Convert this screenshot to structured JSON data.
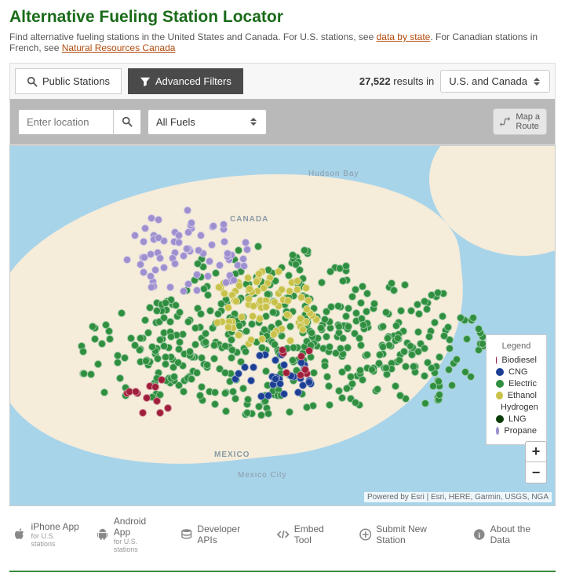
{
  "title": "Alternative Fueling Station Locator",
  "subtitle_parts": {
    "pre": "Find alternative fueling stations in the United States and Canada. For U.S. stations, see ",
    "link1": "data by state",
    "mid": ". For Canadian stations in French, see ",
    "link2": "Natural Resources Canada"
  },
  "tabs": {
    "public": "Public Stations",
    "advanced": "Advanced Filters"
  },
  "results": {
    "count": "27,522",
    "suffix": "results in"
  },
  "region": "U.S. and Canada",
  "search": {
    "placeholder": "Enter location"
  },
  "fuel_select": "All Fuels",
  "route_btn": "Map a\nRoute",
  "map_labels": {
    "hudson": "Hudson Bay",
    "canada": "CANADA",
    "mexico": "MEXICO",
    "mexcity": "Mexico City"
  },
  "legend": {
    "title": "Legend",
    "items": [
      {
        "label": "Biodiesel",
        "color": "#a01f3a"
      },
      {
        "label": "CNG",
        "color": "#1c3f94"
      },
      {
        "label": "Electric",
        "color": "#2f8f3f"
      },
      {
        "label": "Ethanol",
        "color": "#c9c24a"
      },
      {
        "label": "Hydrogen",
        "color": "#8fd4c8"
      },
      {
        "label": "LNG",
        "color": "#0a3d0a"
      },
      {
        "label": "Propane",
        "color": "#9e8fce"
      }
    ]
  },
  "zoom": {
    "in": "+",
    "out": "−"
  },
  "attribution": "Powered by Esri | Esri, HERE, Garmin, USGS, NGA",
  "footer": {
    "iphone": {
      "t": "iPhone App",
      "s": "for U.S. stations"
    },
    "android": {
      "t": "Android App",
      "s": "for U.S. stations"
    },
    "api": "Developer APIs",
    "embed": "Embed Tool",
    "submit": "Submit New Station",
    "about": "About the Data"
  }
}
